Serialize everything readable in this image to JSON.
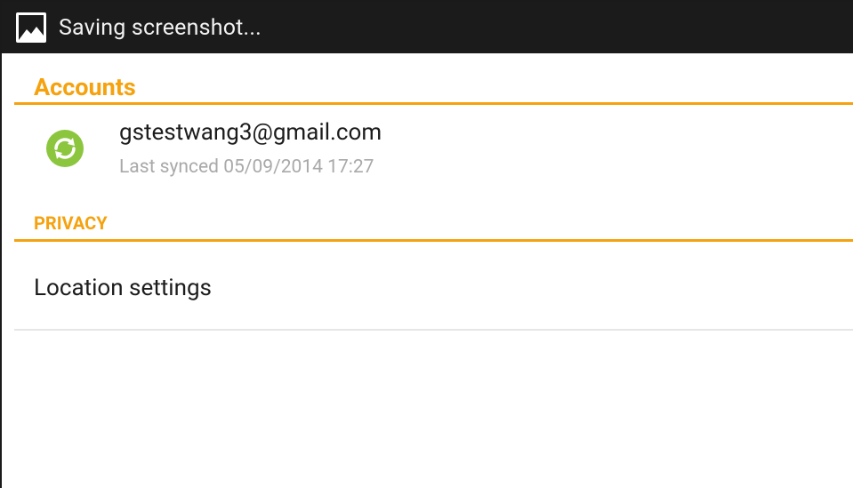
{
  "status_bar": {
    "icon": "image-icon",
    "text": "Saving screenshot..."
  },
  "sections": {
    "accounts": {
      "title": "Accounts"
    },
    "privacy": {
      "title": "PRIVACY"
    }
  },
  "account": {
    "icon": "sync-icon",
    "email": "gstestwang3@gmail.com",
    "last_synced": "Last synced 05/09/2014 17:27"
  },
  "location": {
    "label": "Location settings"
  },
  "colors": {
    "accent": "#f5a20e",
    "sync_green": "#8cc63e",
    "status_bar": "#1b1b1b",
    "secondary_text": "#a9a9a9"
  }
}
